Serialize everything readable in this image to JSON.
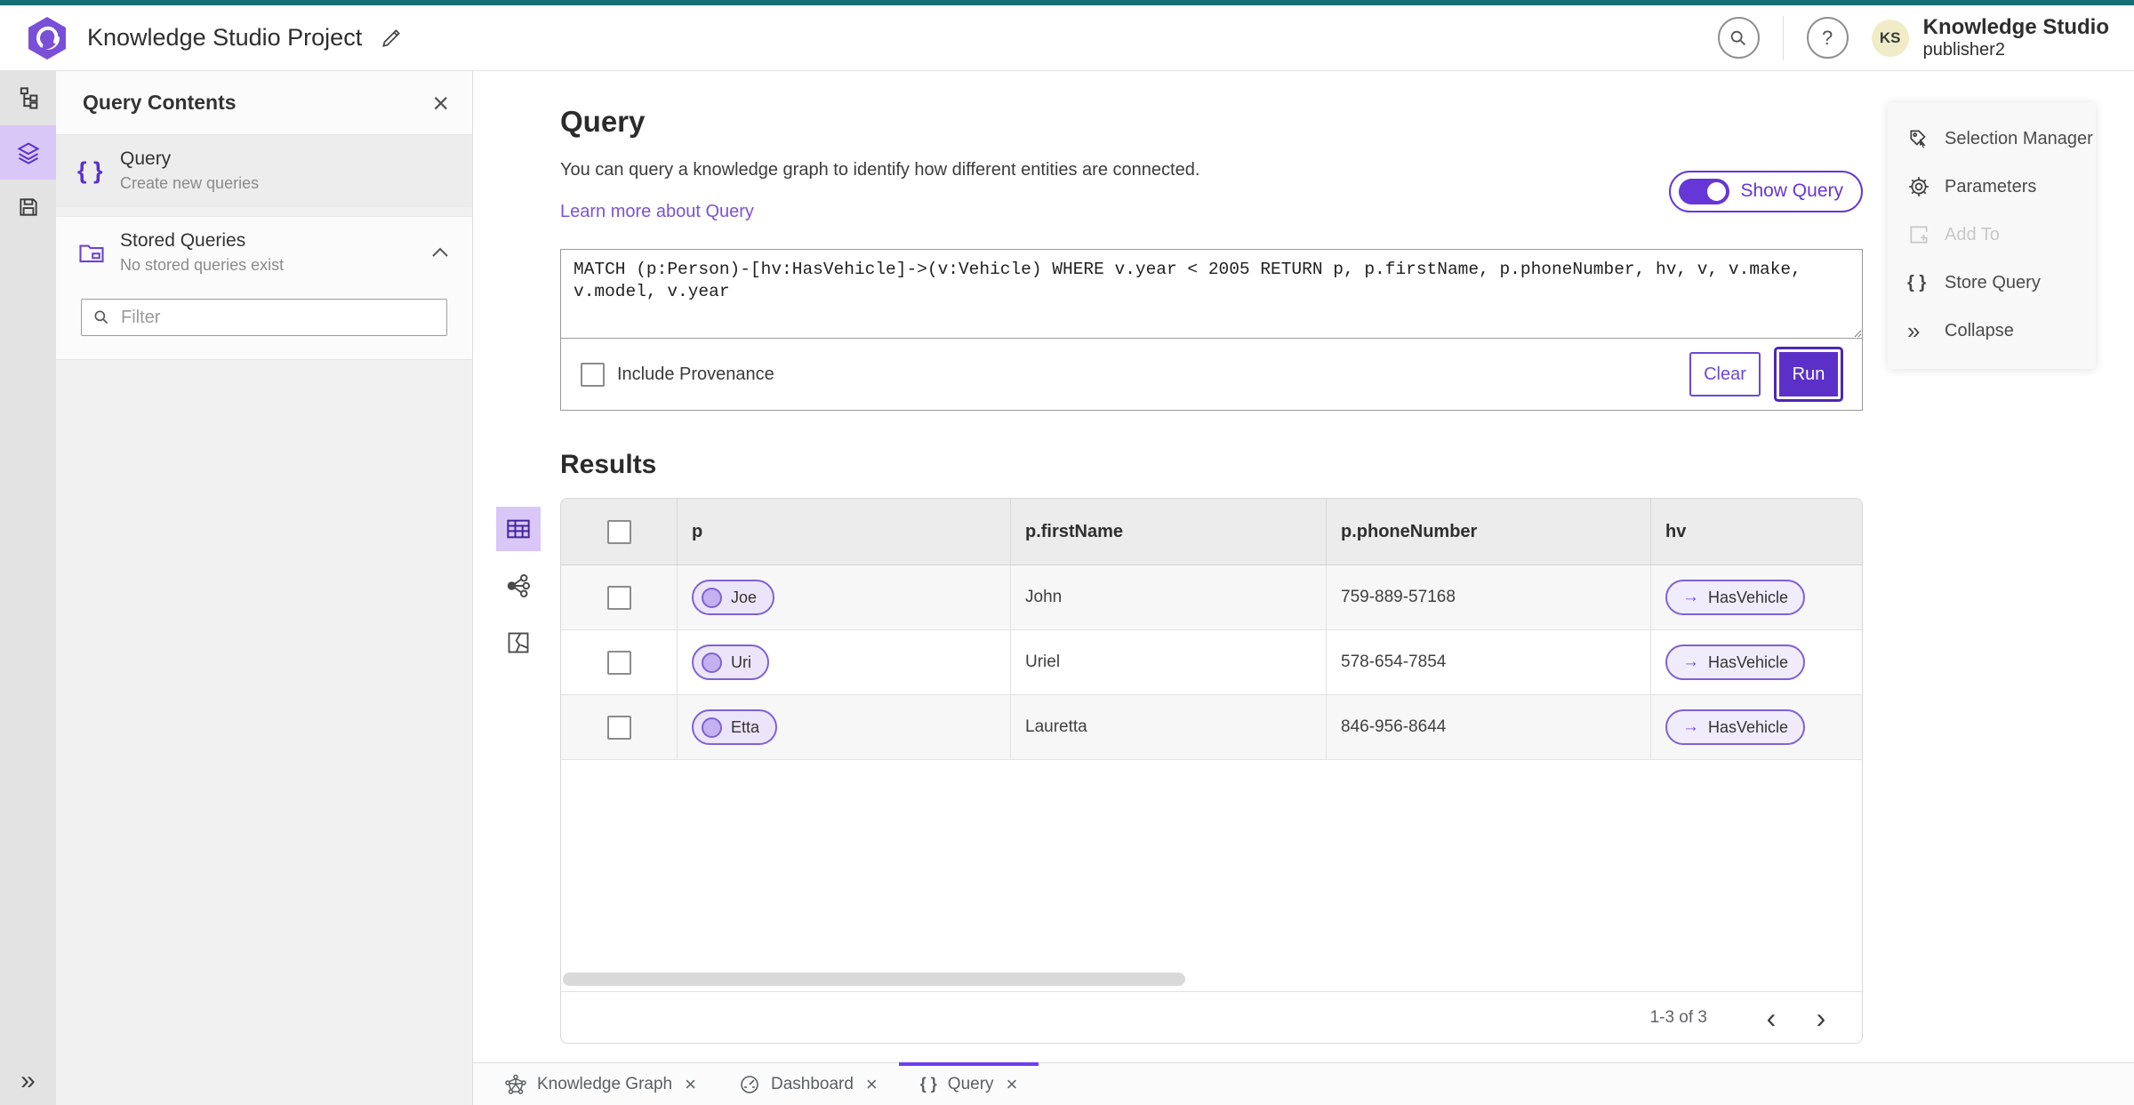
{
  "header": {
    "app_title": "Knowledge Studio Project",
    "help_glyph": "?",
    "avatar_initials": "KS",
    "user_name": "Knowledge Studio",
    "user_role": "publisher2"
  },
  "rail": {
    "expand_glyph": "»"
  },
  "left_panel": {
    "title": "Query Contents",
    "close_glyph": "×",
    "query_item": {
      "icon_glyph": "{ }",
      "title": "Query",
      "subtitle": "Create new queries"
    },
    "stored_item": {
      "title": "Stored Queries",
      "subtitle": "No stored queries exist"
    },
    "filter_placeholder": "Filter"
  },
  "query": {
    "title": "Query",
    "description": "You can query a knowledge graph to identify how different entities are connected.",
    "learn_more_label": "Learn more about Query",
    "show_query_label": "Show Query",
    "show_query_on": true,
    "text": "MATCH (p:Person)-[hv:HasVehicle]->(v:Vehicle) WHERE v.year < 2005 RETURN p, p.firstName, p.phoneNumber, hv, v, v.make, v.model, v.year",
    "include_provenance_label": "Include Provenance",
    "include_provenance_checked": false,
    "clear_label": "Clear",
    "run_label": "Run"
  },
  "results": {
    "title": "Results",
    "columns": [
      "p",
      "p.firstName",
      "p.phoneNumber",
      "hv"
    ],
    "edge_arrow_glyph": "→",
    "rows": [
      {
        "p": "Joe",
        "firstName": "John",
        "phoneNumber": "759-889-57168",
        "hv": "HasVehicle"
      },
      {
        "p": "Uri",
        "firstName": "Uriel",
        "phoneNumber": "578-654-7854",
        "hv": "HasVehicle"
      },
      {
        "p": "Etta",
        "firstName": "Lauretta",
        "phoneNumber": "846-956-8644",
        "hv": "HasVehicle"
      }
    ],
    "pagination": {
      "label": "1-3 of 3",
      "prev_glyph": "‹",
      "next_glyph": "›"
    }
  },
  "right_panel": {
    "items": [
      {
        "label": "Selection Manager"
      },
      {
        "label": "Parameters"
      },
      {
        "label": "Add To",
        "disabled": true
      },
      {
        "label": "Store Query",
        "icon_glyph": "{ }"
      },
      {
        "label": "Collapse",
        "icon_glyph": "»"
      }
    ]
  },
  "tabs": {
    "close_glyph": "×",
    "items": [
      {
        "label": "Knowledge Graph"
      },
      {
        "label": "Dashboard"
      },
      {
        "label": "Query",
        "icon_glyph": "{ }",
        "active": true
      }
    ]
  },
  "colors": {
    "teal_top": "#156e74",
    "accent_purple": "#5b30c9",
    "toggle_purple": "#6636d6",
    "chip_border": "#7e62d1",
    "active_rail_bg": "#d9c7f8",
    "link": "#7a52d6"
  }
}
